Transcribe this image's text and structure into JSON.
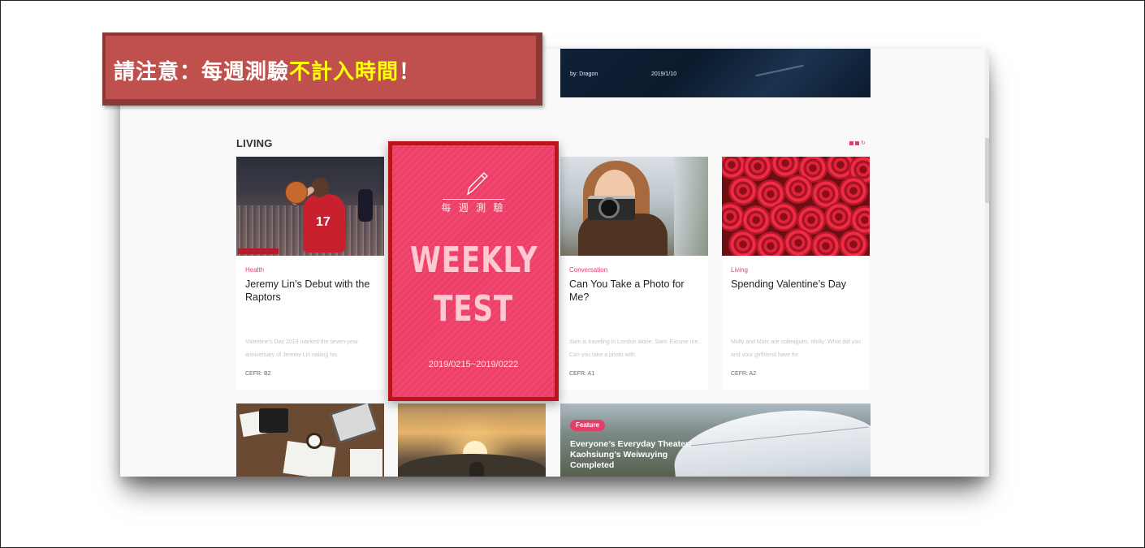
{
  "notice": {
    "text_before": "請注意：每週測驗",
    "highlight": "不計入時間",
    "text_after": "！",
    "bg_color": "#c0504d",
    "highlight_color": "#ffff00"
  },
  "hero": {
    "author": "by: Dragon",
    "date": "2019/1/10"
  },
  "section": {
    "title": "LIVING",
    "layout_icons": [
      "grid-icon",
      "grid-icon",
      "refresh-icon"
    ]
  },
  "cards": [
    {
      "category": "Health",
      "title": "Jeremy Lin’s Debut with the Raptors",
      "excerpt": "Valentine’s Day 2019 marked the seven-year anniversary of Jeremy Lin nailing his",
      "cefr": "CEFR: B2"
    },
    {
      "category": "Conversation",
      "title": "Can You Take a Photo for Me?",
      "excerpt": "Sam is traveling in London alone. Sam: Excuse me. Can you take a photo with",
      "cefr": "CEFR: A1"
    },
    {
      "category": "Living",
      "title": "Spending Valentine’s Day",
      "excerpt": "Molly and Marc are colleagues. Molly: What did you and your girlfriend have for",
      "cefr": "CEFR: A2"
    }
  ],
  "weekly_test": {
    "subtitle": "每 週 測 驗",
    "line1": "WEEKLY",
    "line2": "TEST",
    "date_range": "2019/0215~2019/0222",
    "bg_color": "#ee3f68",
    "border_color": "#b8151d"
  },
  "feature": {
    "badge": "Feature",
    "title": "Everyone’s Everyday Theater: Kaohsiung’s Weiwuying Completed"
  },
  "colors": {
    "accent": "#e0416b"
  }
}
